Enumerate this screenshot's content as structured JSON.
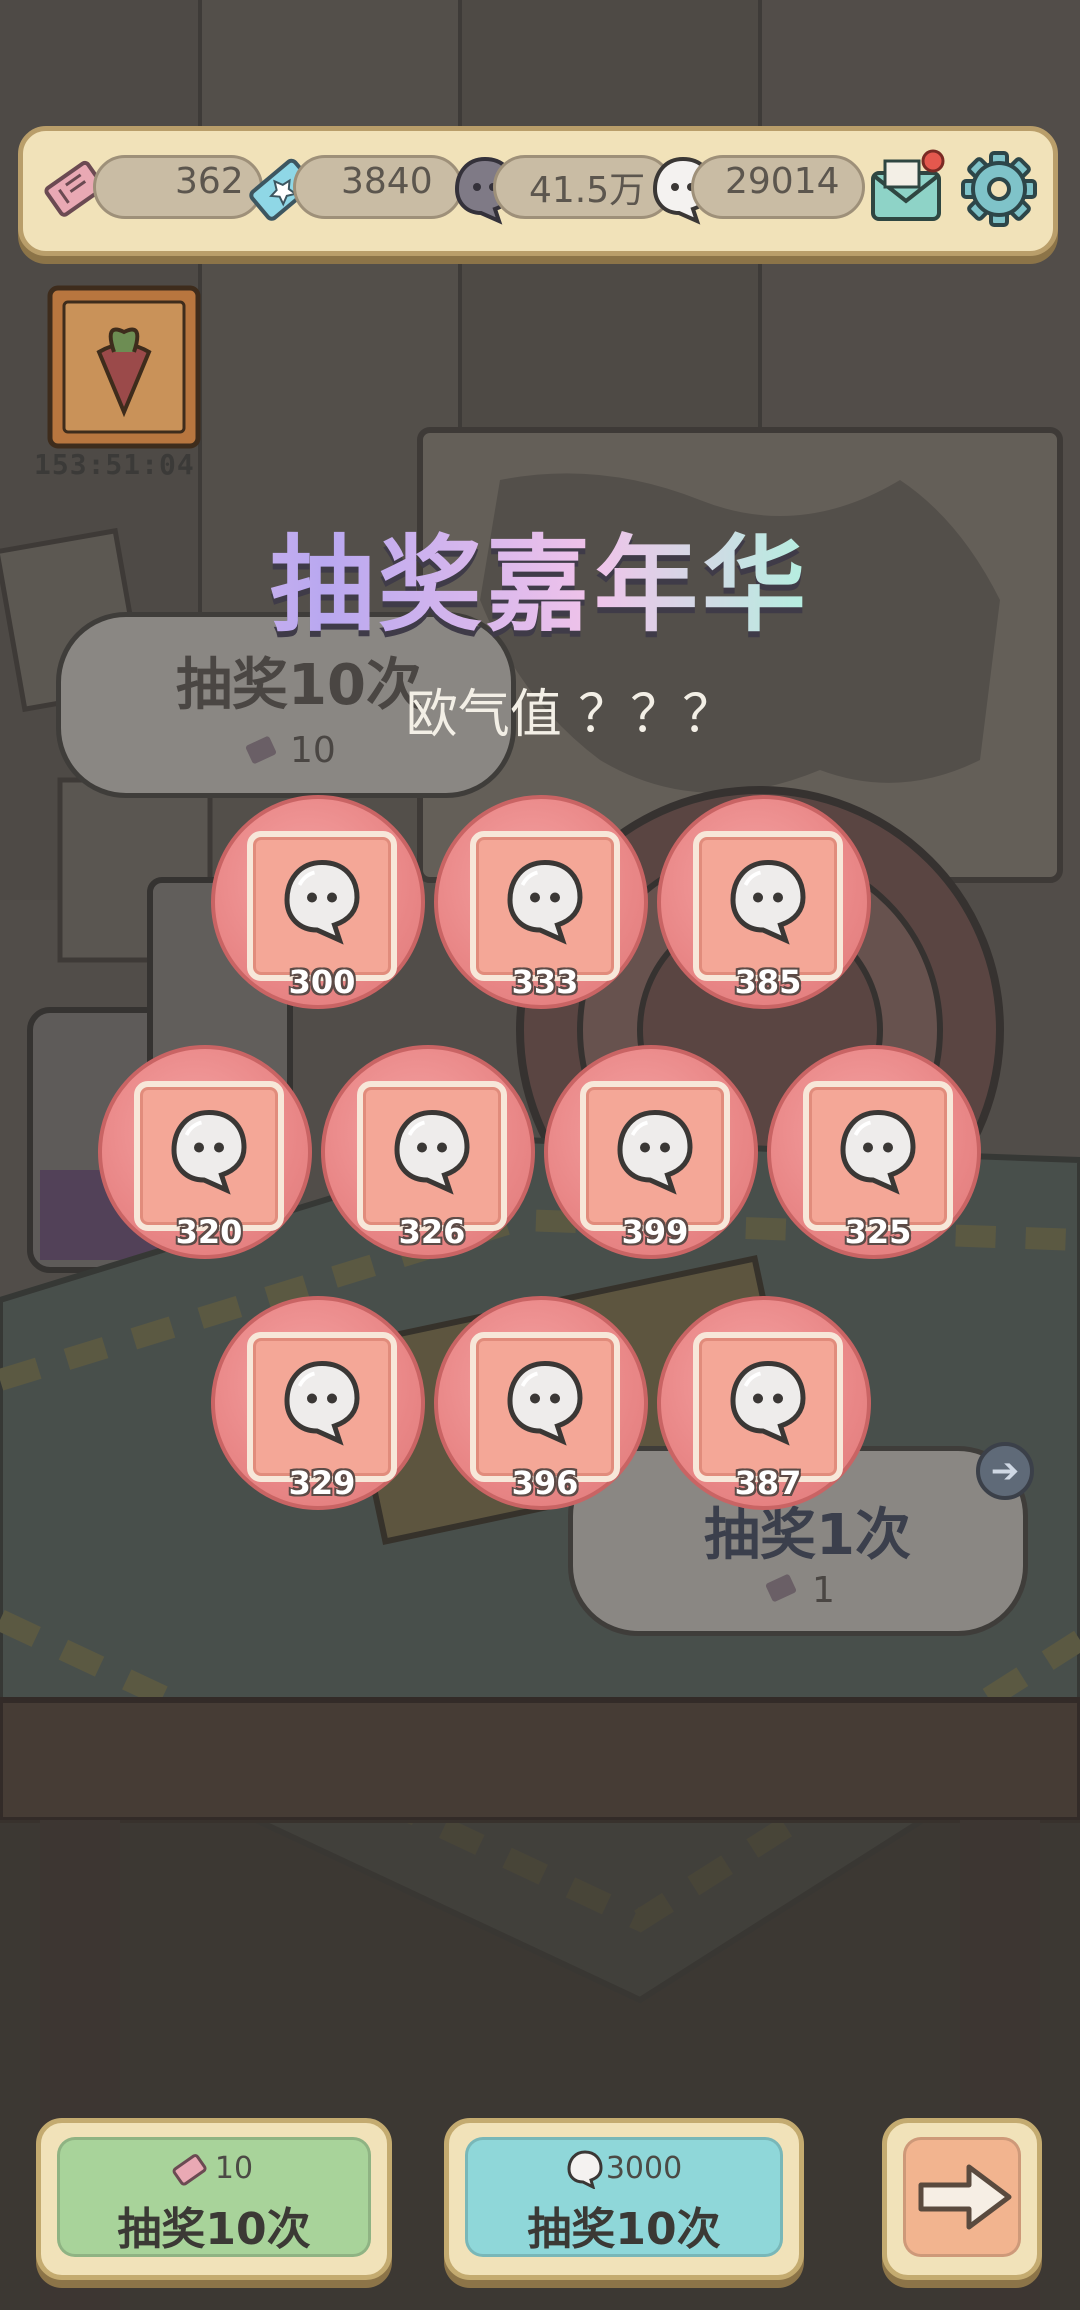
{
  "topbar": {
    "ticket_count": "362",
    "gem_count": "3840",
    "dark_ghost_count": "41.5万",
    "white_ghost_count": "29014",
    "mail_badge": true
  },
  "event": {
    "timer": "153:51:04"
  },
  "title": "抽奖嘉年华",
  "luck_label": "欧气值 ？？？",
  "background_bubbles": {
    "left_label": "抽奖10次",
    "left_cost": "10",
    "right_label": "抽奖1次",
    "right_cost": "1"
  },
  "prizes": [
    {
      "value": "300",
      "icon": "white-ghost-icon"
    },
    {
      "value": "333",
      "icon": "white-ghost-icon"
    },
    {
      "value": "385",
      "icon": "white-ghost-icon"
    },
    {
      "value": "320",
      "icon": "white-ghost-icon"
    },
    {
      "value": "326",
      "icon": "white-ghost-icon"
    },
    {
      "value": "399",
      "icon": "white-ghost-icon"
    },
    {
      "value": "325",
      "icon": "white-ghost-icon"
    },
    {
      "value": "329",
      "icon": "white-ghost-icon"
    },
    {
      "value": "396",
      "icon": "white-ghost-icon"
    },
    {
      "value": "387",
      "icon": "white-ghost-icon"
    }
  ],
  "buttons": {
    "draw10_ticket": {
      "cost": "10",
      "label": "抽奖10次"
    },
    "draw10_ghost": {
      "cost": "3000",
      "label": "抽奖10次"
    }
  },
  "colors": {
    "prize_circle": "#e98787",
    "button_green": "#a8d39a",
    "button_cyan": "#8fd7d9",
    "button_orange": "#f2b48f"
  }
}
